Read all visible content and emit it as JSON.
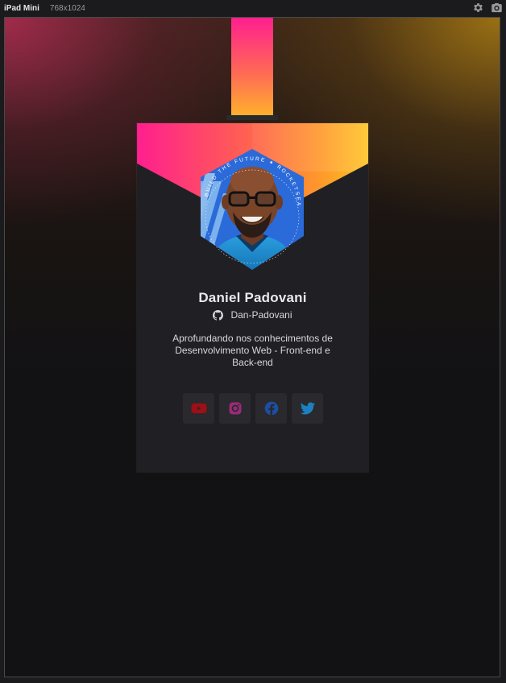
{
  "toolbar": {
    "device": "iPad Mini",
    "dimensions": "768x1024",
    "icons": [
      "gear-icon",
      "camera-icon"
    ]
  },
  "badge": {
    "name": "Daniel Padovani",
    "github_username": "Dan-Padovani",
    "bio": "Aprofundando nos conhecimentos de Desenvolvimento Web - Front-end e Back-end",
    "avatar_ring_text": "BUILD THE FUTURE ✦ ROCKETSEAT",
    "socials": [
      {
        "name": "youtube",
        "icon": "youtube-icon",
        "color": "#a10e14"
      },
      {
        "name": "instagram",
        "icon": "instagram-icon",
        "color": "#9b2a78"
      },
      {
        "name": "facebook",
        "icon": "facebook-icon",
        "color": "#1c4fa3"
      },
      {
        "name": "twitter",
        "icon": "twitter-icon",
        "color": "#1d7fbf"
      }
    ]
  },
  "colors": {
    "gradient_start": "#ff1f8e",
    "gradient_end": "#ffc21f",
    "card_background": "#202024",
    "social_button_background": "#29292e"
  }
}
